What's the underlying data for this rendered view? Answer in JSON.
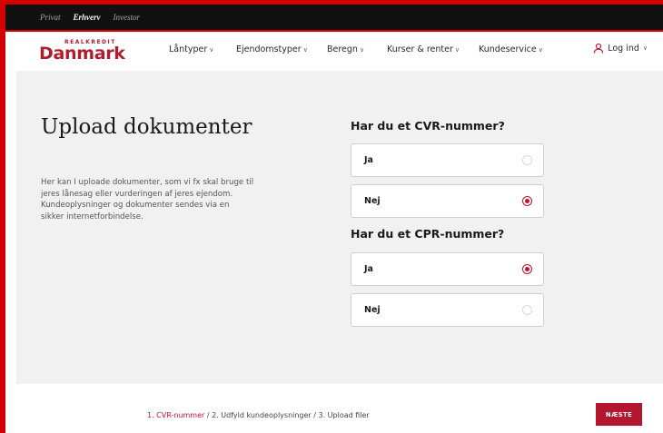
{
  "segments": [
    {
      "label": "Privat",
      "active": false
    },
    {
      "label": "Erhverv",
      "active": true
    },
    {
      "label": "Investor",
      "active": false
    }
  ],
  "brand": {
    "small": "REALKREDIT",
    "main": "Danmark",
    "color": "#b01c2e"
  },
  "nav": {
    "items": [
      "Låntyper",
      "Ejendomstyper",
      "Beregn",
      "Kurser & renter",
      "Kundeservice"
    ],
    "login": "Log ind",
    "chevron_icon": "chevron-down-icon",
    "user_icon": "user-icon"
  },
  "intro": {
    "title": "Upload dokumenter",
    "description": "Her kan I uploade dokumenter, som vi fx skal bruge til jeres lånesag eller vurderingen af jeres ejendom. Kundeoplysninger og dokumenter sendes via en sikker internetforbindelse."
  },
  "questions": [
    {
      "title": "Har du et CVR-nummer?",
      "options": [
        {
          "label": "Ja",
          "selected": false
        },
        {
          "label": "Nej",
          "selected": true
        }
      ]
    },
    {
      "title": "Har du et CPR-nummer?",
      "options": [
        {
          "label": "Ja",
          "selected": true
        },
        {
          "label": "Nej",
          "selected": false
        }
      ]
    }
  ],
  "footer": {
    "steps": {
      "current": "1. CVR-nummer",
      "rest": " / 2. Udfyld kundeoplysninger / 3. Upload filer"
    },
    "next_button": "NÆSTE"
  },
  "colors": {
    "accent": "#c8102e",
    "button": "#b3162f",
    "background": "#f1f1f1",
    "frame": "#d40000"
  }
}
